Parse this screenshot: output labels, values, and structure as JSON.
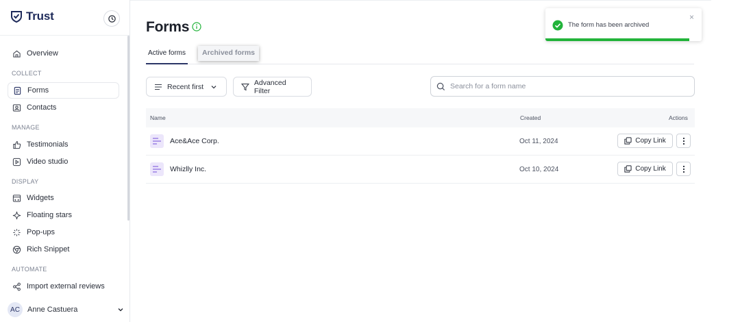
{
  "brand": {
    "name": "Trust"
  },
  "sidebar": {
    "sections": {
      "collect": "COLLECT",
      "manage": "MANAGE",
      "display": "DISPLAY",
      "automate": "AUTOMATE"
    },
    "items": {
      "overview": "Overview",
      "forms": "Forms",
      "contacts": "Contacts",
      "testimonials": "Testimonials",
      "video_studio": "Video studio",
      "widgets": "Widgets",
      "floating_stars": "Floating stars",
      "popups": "Pop-ups",
      "rich_snippet": "Rich Snippet",
      "import_reviews": "Import external reviews"
    },
    "active": "forms",
    "user": {
      "initials": "AC",
      "name": "Anne Castuera"
    }
  },
  "page": {
    "title": "Forms"
  },
  "tabs": {
    "active": "Active forms",
    "archived": "Archived forms"
  },
  "toolbar": {
    "sort_label": "Recent first",
    "filter_label": "Advanced Filter",
    "search_placeholder": "Search for a form name"
  },
  "table": {
    "headers": {
      "name": "Name",
      "created": "Created",
      "actions": "Actions"
    },
    "rows": [
      {
        "name": "Ace&Ace Corp.",
        "created": "Oct 11, 2024",
        "action": "Copy Link"
      },
      {
        "name": "Whizlly Inc.",
        "created": "Oct 10, 2024",
        "action": "Copy Link"
      }
    ]
  },
  "toast": {
    "message": "The form has been archived",
    "close": "×",
    "progress": 0.92
  },
  "colors": {
    "brand": "#1e2a5a",
    "success": "#22b33a",
    "form_icon_bg": "#ece6fb",
    "form_icon_lines": "#8b6ee0"
  }
}
